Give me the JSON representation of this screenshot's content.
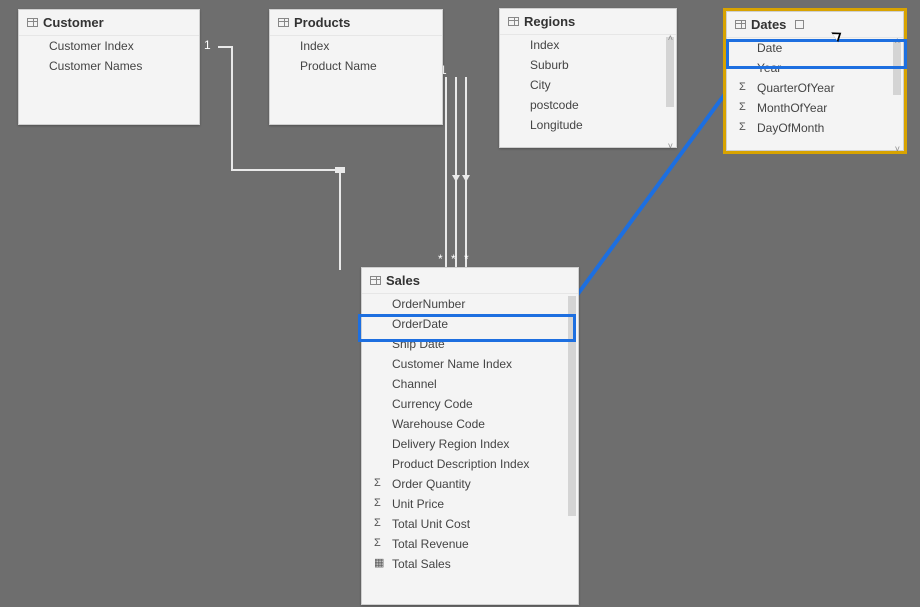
{
  "tables": {
    "customer": {
      "title": "Customer",
      "fields": [
        {
          "label": "Customer Index",
          "icon": ""
        },
        {
          "label": "Customer Names",
          "icon": ""
        }
      ]
    },
    "products": {
      "title": "Products",
      "fields": [
        {
          "label": "Index",
          "icon": ""
        },
        {
          "label": "Product Name",
          "icon": ""
        }
      ]
    },
    "regions": {
      "title": "Regions",
      "fields": [
        {
          "label": "Index",
          "icon": ""
        },
        {
          "label": "Suburb",
          "icon": ""
        },
        {
          "label": "City",
          "icon": ""
        },
        {
          "label": "postcode",
          "icon": ""
        },
        {
          "label": "Longitude",
          "icon": ""
        }
      ]
    },
    "dates": {
      "title": "Dates",
      "fields": [
        {
          "label": "Date",
          "icon": ""
        },
        {
          "label": "Year",
          "icon": ""
        },
        {
          "label": "QuarterOfYear",
          "icon": "Σ"
        },
        {
          "label": "MonthOfYear",
          "icon": "Σ"
        },
        {
          "label": "DayOfMonth",
          "icon": "Σ"
        }
      ]
    },
    "sales": {
      "title": "Sales",
      "fields": [
        {
          "label": "OrderNumber",
          "icon": ""
        },
        {
          "label": "OrderDate",
          "icon": ""
        },
        {
          "label": "Ship Date",
          "icon": ""
        },
        {
          "label": "Customer Name Index",
          "icon": ""
        },
        {
          "label": "Channel",
          "icon": ""
        },
        {
          "label": "Currency Code",
          "icon": ""
        },
        {
          "label": "Warehouse Code",
          "icon": ""
        },
        {
          "label": "Delivery Region Index",
          "icon": ""
        },
        {
          "label": "Product Description Index",
          "icon": ""
        },
        {
          "label": "Order Quantity",
          "icon": "Σ"
        },
        {
          "label": "Unit Price",
          "icon": "Σ"
        },
        {
          "label": "Total Unit Cost",
          "icon": "Σ"
        },
        {
          "label": "Total Revenue",
          "icon": "Σ"
        },
        {
          "label": "Total Sales",
          "icon": "▦"
        }
      ]
    }
  },
  "relationships": {
    "one_label": "1",
    "many_label": "*"
  },
  "colors": {
    "highlight": "#1d6fe0",
    "selected": "#d8a300"
  }
}
